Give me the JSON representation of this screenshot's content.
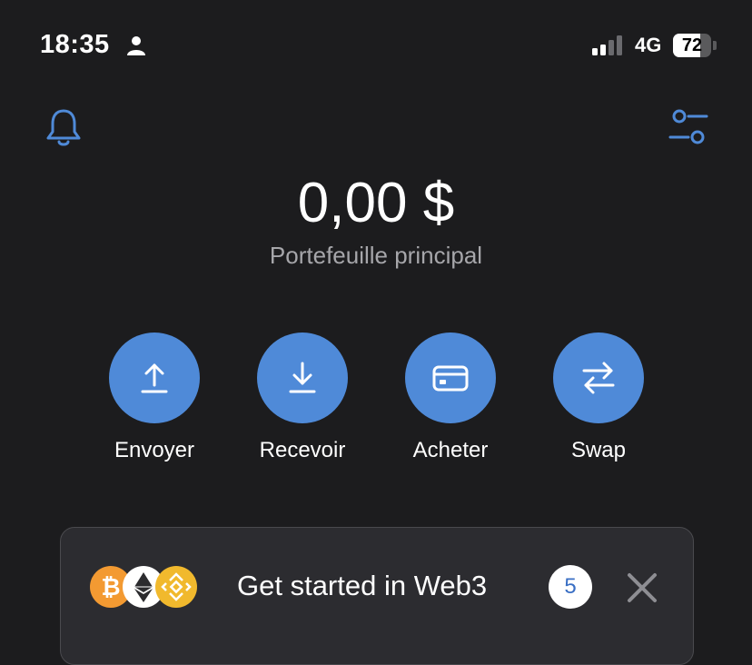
{
  "status_bar": {
    "time": "18:35",
    "network": "4G",
    "battery": "72",
    "battery_level": 0.72
  },
  "icons": {
    "person": "person-icon",
    "signal": "signal-bars-icon",
    "bell": "bell-icon",
    "settings": "sliders-icon",
    "send": "arrow-up-icon",
    "receive": "arrow-down-icon",
    "buy": "credit-card-icon",
    "swap": "swap-arrows-icon",
    "close": "close-icon"
  },
  "wallet": {
    "balance": "0,00 $",
    "name": "Portefeuille principal"
  },
  "actions": [
    {
      "label": "Envoyer"
    },
    {
      "label": "Recevoir"
    },
    {
      "label": "Acheter"
    },
    {
      "label": "Swap"
    }
  ],
  "banner": {
    "title": "Get started in Web3",
    "count": "5",
    "coins": [
      "bitcoin-icon",
      "ethereum-icon",
      "bnb-icon"
    ]
  },
  "colors": {
    "background": "#1c1c1e",
    "accent": "#4f8ad8",
    "muted_text": "#a6a6aa",
    "card": "#2c2c30",
    "btc": "#f39a32",
    "bnb": "#f1b92d"
  }
}
